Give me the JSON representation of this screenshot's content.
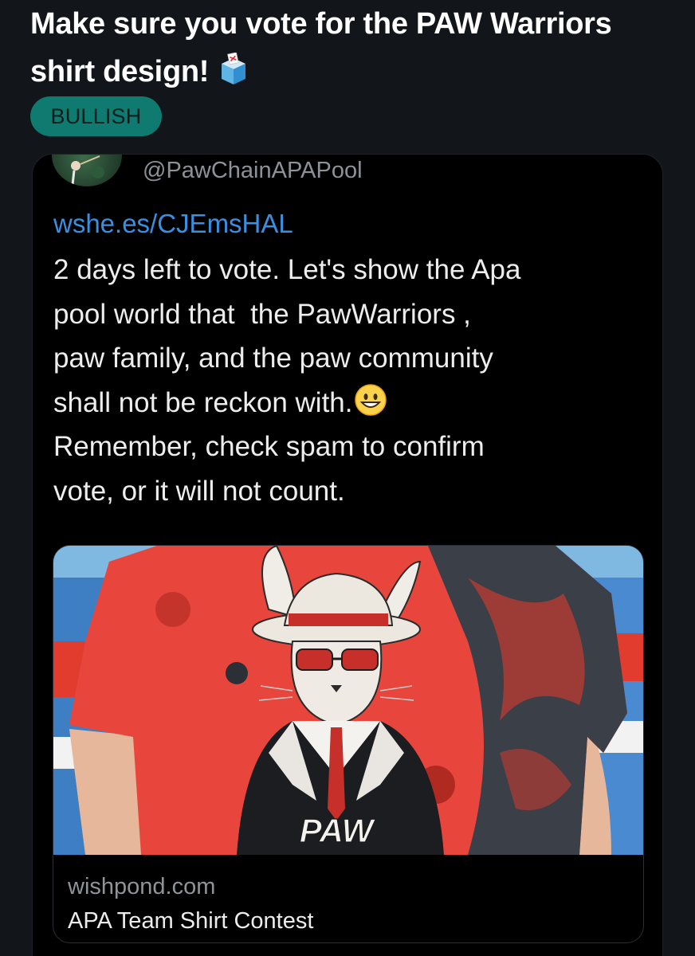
{
  "post": {
    "title_line1": "Make sure you vote for the PAW Warriors",
    "title_line2": "shirt design!",
    "title_emoji": "ballot-box-icon",
    "badge": "BULLISH"
  },
  "embed": {
    "handle": "@PawChainAPAPool",
    "link": "wshe.es/CJEmsHAL",
    "text_lines": [
      "2 days left to vote. Let's show the Apa",
      "pool world that  the PawWarriors ,",
      "paw family, and the paw community",
      "shall not be reckon with.",
      "Remember, check spam to confirm",
      "vote, or it will not count."
    ],
    "inline_emoji": "smiley-icon",
    "card": {
      "image_text": "PAW",
      "domain": "wishpond.com",
      "title": "APA Team Shirt Contest"
    }
  },
  "colors": {
    "background": "#12151a",
    "badge_bg": "#0f7a70",
    "link": "#3a8fe0",
    "shirt_red": "#e8463c"
  }
}
